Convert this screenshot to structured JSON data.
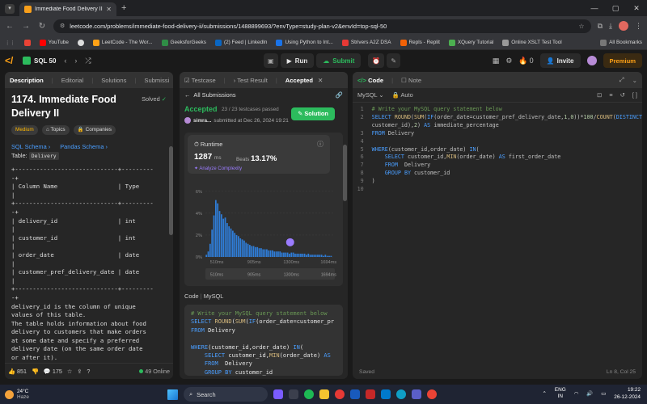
{
  "browser": {
    "tab_title": "Immediate Food Delivery II - Le",
    "url": "leetcode.com/problems/immediate-food-delivery-ii/submissions/1488899693/?envType=study-plan-v2&envId=top-sql-50",
    "bookmarks": [
      "YouTube",
      "LeetCode - The Wor...",
      "GeeksforGeeks",
      "(2) Feed | LinkedIn",
      "Using Python to Int...",
      "Strivers A2Z DSA",
      "Repls - Replit",
      "XQuery Tutorial",
      "Online XSLT Test Tool"
    ],
    "all_bookmarks": "All Bookmarks"
  },
  "lc_header": {
    "study_plan": "SQL 50",
    "run": "Run",
    "submit": "Submit",
    "streak": "0",
    "invite": "Invite",
    "premium": "Premium"
  },
  "left": {
    "tabs": [
      "Description",
      "Editorial",
      "Solutions",
      "Submissi"
    ],
    "title": "1174. Immediate Food Delivery II",
    "solved": "Solved",
    "difficulty": "Medium",
    "topics": "Topics",
    "companies": "Companies",
    "sql_schema": "SQL Schema",
    "pandas_schema": "Pandas Schema",
    "table_label": "Table:",
    "table_name": "Delivery",
    "schema_lines": [
      "+-----------------------------+---------",
      "-+",
      "| Column Name                 | Type",
      "|",
      "+-----------------------------+---------",
      "-+",
      "| delivery_id                 | int",
      "|",
      "| customer_id                 | int",
      "|",
      "| order_date                  | date",
      "|",
      "| customer_pref_delivery_date | date",
      "|",
      "+-----------------------------+---------",
      "-+"
    ],
    "desc_lines": [
      "delivery_id is the column of unique",
      "values of this table.",
      "The table holds information about food",
      "delivery to customers that make orders",
      "at some date and specify a preferred",
      "delivery date (on the same order date",
      "or after it)."
    ],
    "likes": "851",
    "comments": "175",
    "online": "49 Online"
  },
  "middle": {
    "tabs": [
      "Testcase",
      "Test Result",
      "Accepted"
    ],
    "all_submissions": "All Submissions",
    "status": "Accepted",
    "passed": "23 / 23 testcases passed",
    "user": "simra...",
    "submitted": "submitted at Dec 26, 2024 19:21",
    "solution_btn": "Solution",
    "runtime_label": "Runtime",
    "runtime_value": "1287",
    "runtime_unit": "ms",
    "beats_label": "Beats",
    "beats_value": "13.17%",
    "analyze": "Analyze Complexity",
    "code_label": "Code",
    "code_lang": "MySQL"
  },
  "chart_data": {
    "type": "bar",
    "title": "",
    "x_ticks": [
      "510ms",
      "905ms",
      "1300ms",
      "1694ms"
    ],
    "y_ticks": [
      "0%",
      "2%",
      "4%",
      "6%"
    ],
    "ylim": [
      0,
      6.5
    ],
    "x_range": [
      390,
      1760
    ],
    "marker_x": 1287,
    "x": [
      400,
      420,
      440,
      460,
      480,
      500,
      520,
      540,
      560,
      580,
      600,
      620,
      640,
      660,
      680,
      700,
      720,
      740,
      760,
      780,
      800,
      820,
      840,
      860,
      880,
      900,
      920,
      940,
      960,
      980,
      1000,
      1020,
      1040,
      1060,
      1080,
      1100,
      1120,
      1140,
      1160,
      1180,
      1200,
      1220,
      1240,
      1260,
      1280,
      1300,
      1320,
      1340,
      1360,
      1380,
      1400,
      1420,
      1440,
      1460,
      1480,
      1500,
      1520,
      1540,
      1560,
      1580,
      1600,
      1620,
      1640,
      1660,
      1680,
      1700,
      1720
    ],
    "values": [
      0.2,
      0.5,
      1.2,
      2.5,
      3.8,
      5.2,
      4.9,
      4.2,
      3.9,
      3.5,
      3.6,
      3.1,
      2.8,
      2.6,
      2.4,
      2.2,
      2.0,
      1.9,
      1.7,
      1.6,
      1.5,
      1.3,
      1.2,
      1.1,
      1.0,
      1.0,
      0.9,
      0.9,
      0.8,
      0.8,
      0.7,
      0.7,
      0.7,
      0.6,
      0.6,
      0.6,
      0.5,
      0.5,
      0.5,
      0.5,
      0.4,
      0.4,
      0.4,
      0.4,
      0.3,
      0.4,
      0.4,
      0.3,
      0.3,
      0.3,
      0.3,
      0.3,
      0.3,
      0.2,
      0.3,
      0.2,
      0.2,
      0.2,
      0.2,
      0.2,
      0.2,
      0.2,
      0.1,
      0.2,
      0.1,
      0.1,
      0.1
    ]
  },
  "right": {
    "tabs": [
      "Code",
      "Note"
    ],
    "lang": "MySQL",
    "auto": "Auto",
    "saved": "Saved",
    "cursor": "Ln 8, Col 25"
  },
  "taskbar": {
    "temp": "24°C",
    "weather": "Haze",
    "search": "Search",
    "lang1": "ENG",
    "lang2": "IN",
    "time": "19:22",
    "date": "26-12-2024"
  }
}
